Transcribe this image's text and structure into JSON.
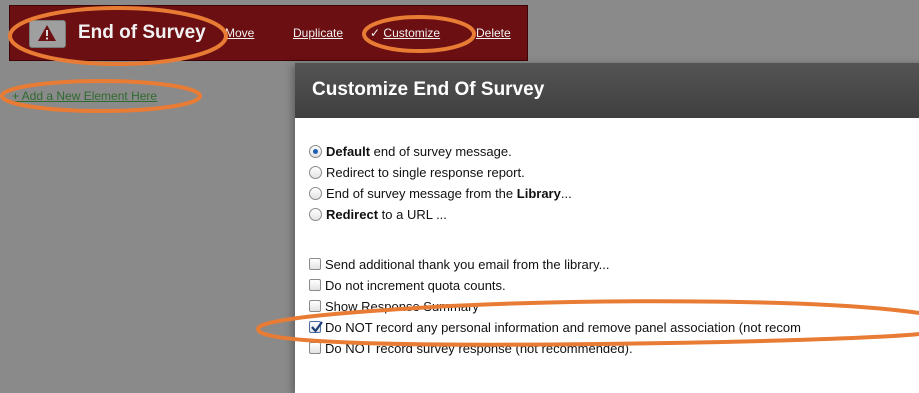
{
  "header": {
    "title": "End of Survey",
    "links": {
      "move": "Move",
      "duplicate": "Duplicate",
      "customize": "Customize",
      "delete": "Delete"
    },
    "customize_check": "✓"
  },
  "add_element_link": "+ Add a New Element Here",
  "dialog": {
    "title": "Customize End Of Survey",
    "radio_options": [
      {
        "bold": "Default",
        "rest": " end of survey message.",
        "checked": true
      },
      {
        "bold": "",
        "rest": "Redirect to single response report.",
        "checked": false
      },
      {
        "pre": "End of survey message from the ",
        "bold": "Library",
        "post": "...",
        "checked": false
      },
      {
        "bold": "Redirect",
        "rest": " to a URL ...",
        "checked": false
      }
    ],
    "checkbox_options": [
      {
        "label": "Send additional thank you email from the library...",
        "checked": false
      },
      {
        "label": "Do not increment quota counts.",
        "checked": false
      },
      {
        "label": "Show Response Summary",
        "checked": false
      },
      {
        "label": "Do NOT record any personal information and remove panel association (not recom",
        "checked": true
      },
      {
        "label": "Do NOT record survey response (not recommended).",
        "checked": false
      }
    ]
  },
  "colors": {
    "header_bg": "#6b0f12",
    "annotation": "#e87c35",
    "dialog_header": "#4a4a4a",
    "page_bg": "#8a8a8a",
    "link_green": "#2f6a2f"
  },
  "icons": {
    "warning": "warning-icon",
    "check": "check-icon"
  }
}
